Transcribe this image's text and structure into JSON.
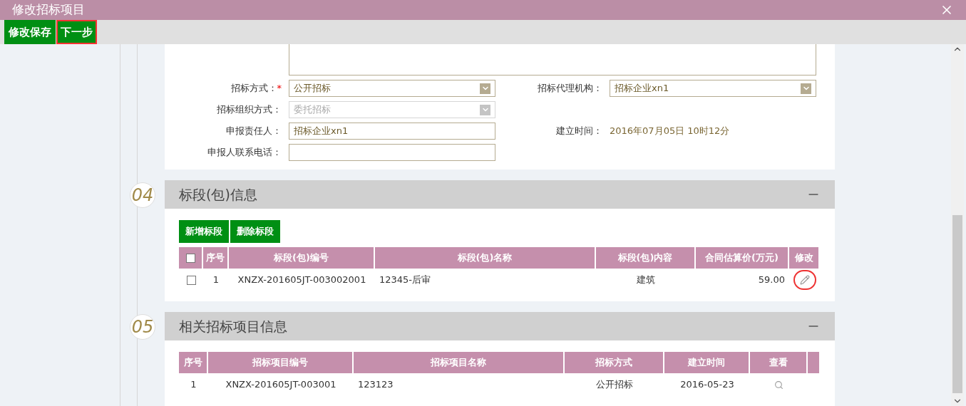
{
  "window": {
    "title": "修改招标项目"
  },
  "toolbar": [
    {
      "label": "修改保存",
      "highlighted": false
    },
    {
      "label": "下一步",
      "highlighted": true
    }
  ],
  "form": {
    "left": [
      {
        "label": "招标方式：",
        "required_mark": "*",
        "kind": "select",
        "value": "公开招标",
        "disabled": false
      },
      {
        "label": "招标组织方式：",
        "kind": "select",
        "value": "委托招标",
        "disabled": true
      },
      {
        "label": "申报责任人：",
        "kind": "input",
        "value": "招标企业xn1",
        "disabled": false
      },
      {
        "label": "申报人联系电话：",
        "kind": "input",
        "disabled": false
      }
    ],
    "right": [
      {
        "label": "招标代理机构：",
        "kind": "select",
        "value": "招标企业xn1"
      },
      {
        "label": "建立时间：",
        "kind": "text",
        "value": "2016年07月05日 10时12分"
      }
    ]
  },
  "sections": [
    {
      "number": "04",
      "title": "标段(包)信息",
      "buttons": [
        "新增标段",
        "删除标段"
      ],
      "table": {
        "columns": [
          {
            "kind": "checkbox",
            "checked": false
          },
          {
            "label": "序号"
          },
          {
            "label": "标段(包)编号"
          },
          {
            "label": "标段(包)名称"
          },
          {
            "label": "标段(包)内容"
          },
          {
            "label": "合同估算价(万元)"
          },
          {
            "label": "修改"
          }
        ],
        "rows": [
          {
            "cells": [
              {
                "kind": "checkbox",
                "checked": false
              },
              "1",
              "XNZX-201605JT-003002001",
              "12345-后审",
              "建筑",
              "59.00",
              {
                "kind": "edit",
                "highlighted": true
              }
            ]
          }
        ]
      }
    },
    {
      "number": "05",
      "title": "相关招标项目信息",
      "table": {
        "columns": [
          {
            "label": "序号"
          },
          {
            "label": "招标项目编号"
          },
          {
            "label": "招标项目名称"
          },
          {
            "label": "招标方式"
          },
          {
            "label": "建立时间"
          },
          {
            "label": "查看"
          },
          {
            "kind": "blank"
          }
        ],
        "rows": [
          {
            "cells": [
              "1",
              "XNZX-201605JT-003001",
              "123123",
              "公开招标",
              "2016-05-23",
              {
                "kind": "view",
                "highlighted": false
              }
            ]
          }
        ]
      }
    }
  ]
}
